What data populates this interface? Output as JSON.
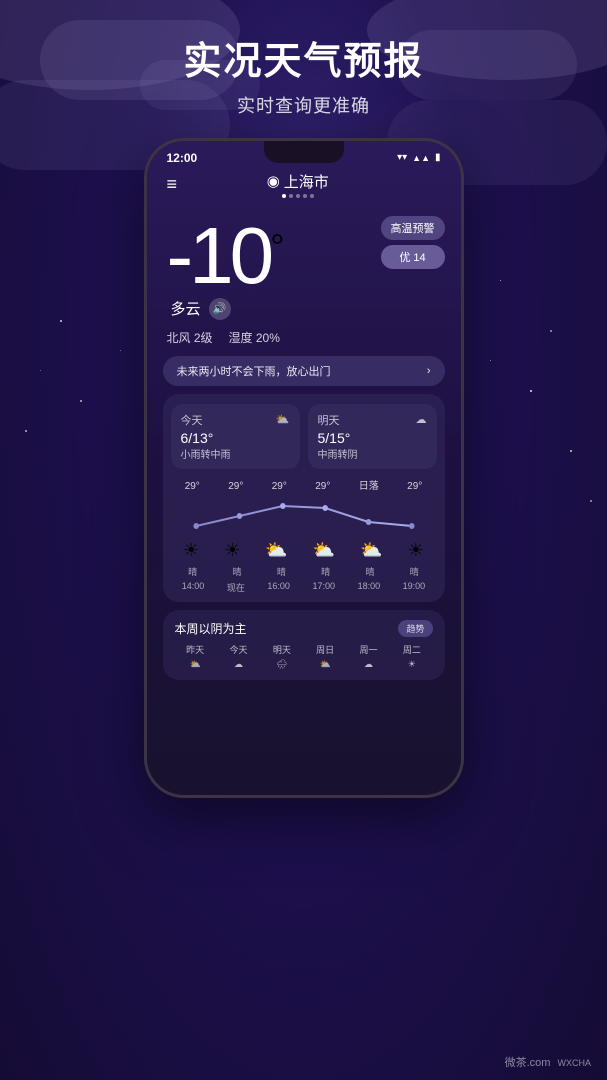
{
  "background": {
    "gradient_start": "#2a1a5a",
    "gradient_end": "#150c35"
  },
  "title": {
    "main": "实况天气预报",
    "sub": "实时查询更准确"
  },
  "status_bar": {
    "time": "12:00",
    "signal_icon": "▲▲",
    "battery_icon": "▮"
  },
  "nav": {
    "menu_icon": "≡",
    "location_pin": "◉",
    "city": "上海市",
    "dots": [
      1,
      2,
      3,
      4,
      5
    ]
  },
  "weather": {
    "temperature": "-10",
    "degree_symbol": "°",
    "condition": "多云",
    "speaker_icon": "🔊",
    "wind": "北风 2级",
    "humidity": "湿度 20%",
    "rain_forecast": "未来两小时不会下雨，放心出门",
    "rain_arrow": "›"
  },
  "alerts": {
    "high_temp": "高温预警",
    "aqi": "优 14"
  },
  "forecast_cards": [
    {
      "label": "今天",
      "icon": "⛅",
      "temps": "6/13°",
      "desc": "小雨转中雨"
    },
    {
      "label": "明天",
      "icon": "☁",
      "temps": "5/15°",
      "desc": "中雨转阴"
    }
  ],
  "hourly": {
    "temps": [
      "29°",
      "29°",
      "29°",
      "29°",
      "日落",
      "29°"
    ],
    "icons": [
      "☀",
      "☀",
      "⛅",
      "⛅",
      "⛅",
      "☀"
    ],
    "labels": [
      "晴",
      "晴",
      "晴",
      "晴",
      "晴",
      "晴"
    ],
    "times": [
      "14:00",
      "现在",
      "16:00",
      "17:00",
      "18:00",
      "19:00"
    ],
    "chart_values": [
      28,
      32,
      35,
      34,
      30,
      28
    ]
  },
  "weekly": {
    "title": "本周以阴为主",
    "trend_btn": "趋势",
    "days": [
      "昨天",
      "今天",
      "明天",
      "周日",
      "周一",
      "周二"
    ],
    "icons": [
      "⛅",
      "☁",
      "🌧",
      "⛅",
      "☁",
      "☀"
    ]
  },
  "watermark": {
    "brand": "微茶",
    "suffix": ".com",
    "wxcha": "WXCHA"
  }
}
